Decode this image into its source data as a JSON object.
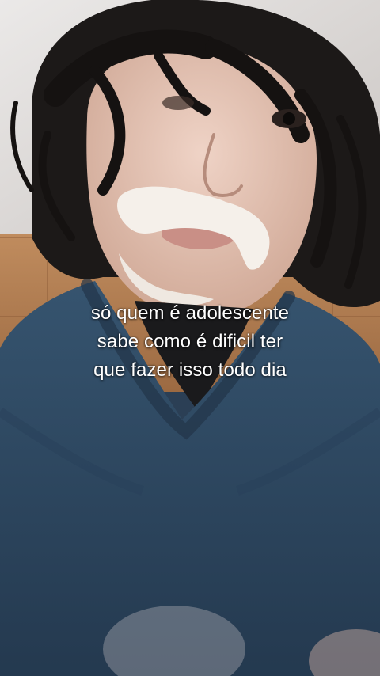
{
  "caption": {
    "line1": "só quem é adolescente",
    "line2": "sabe como é dificil ter",
    "line3": "que fazer isso todo dia"
  },
  "colors": {
    "hoodie": "#2e4a66",
    "wall": "#d9d6d4",
    "tile": "#b07a4e",
    "hair": "#1a1716",
    "skin": "#e6c9bc",
    "cream": "#f4efe9",
    "caption_text": "#ffffff"
  }
}
